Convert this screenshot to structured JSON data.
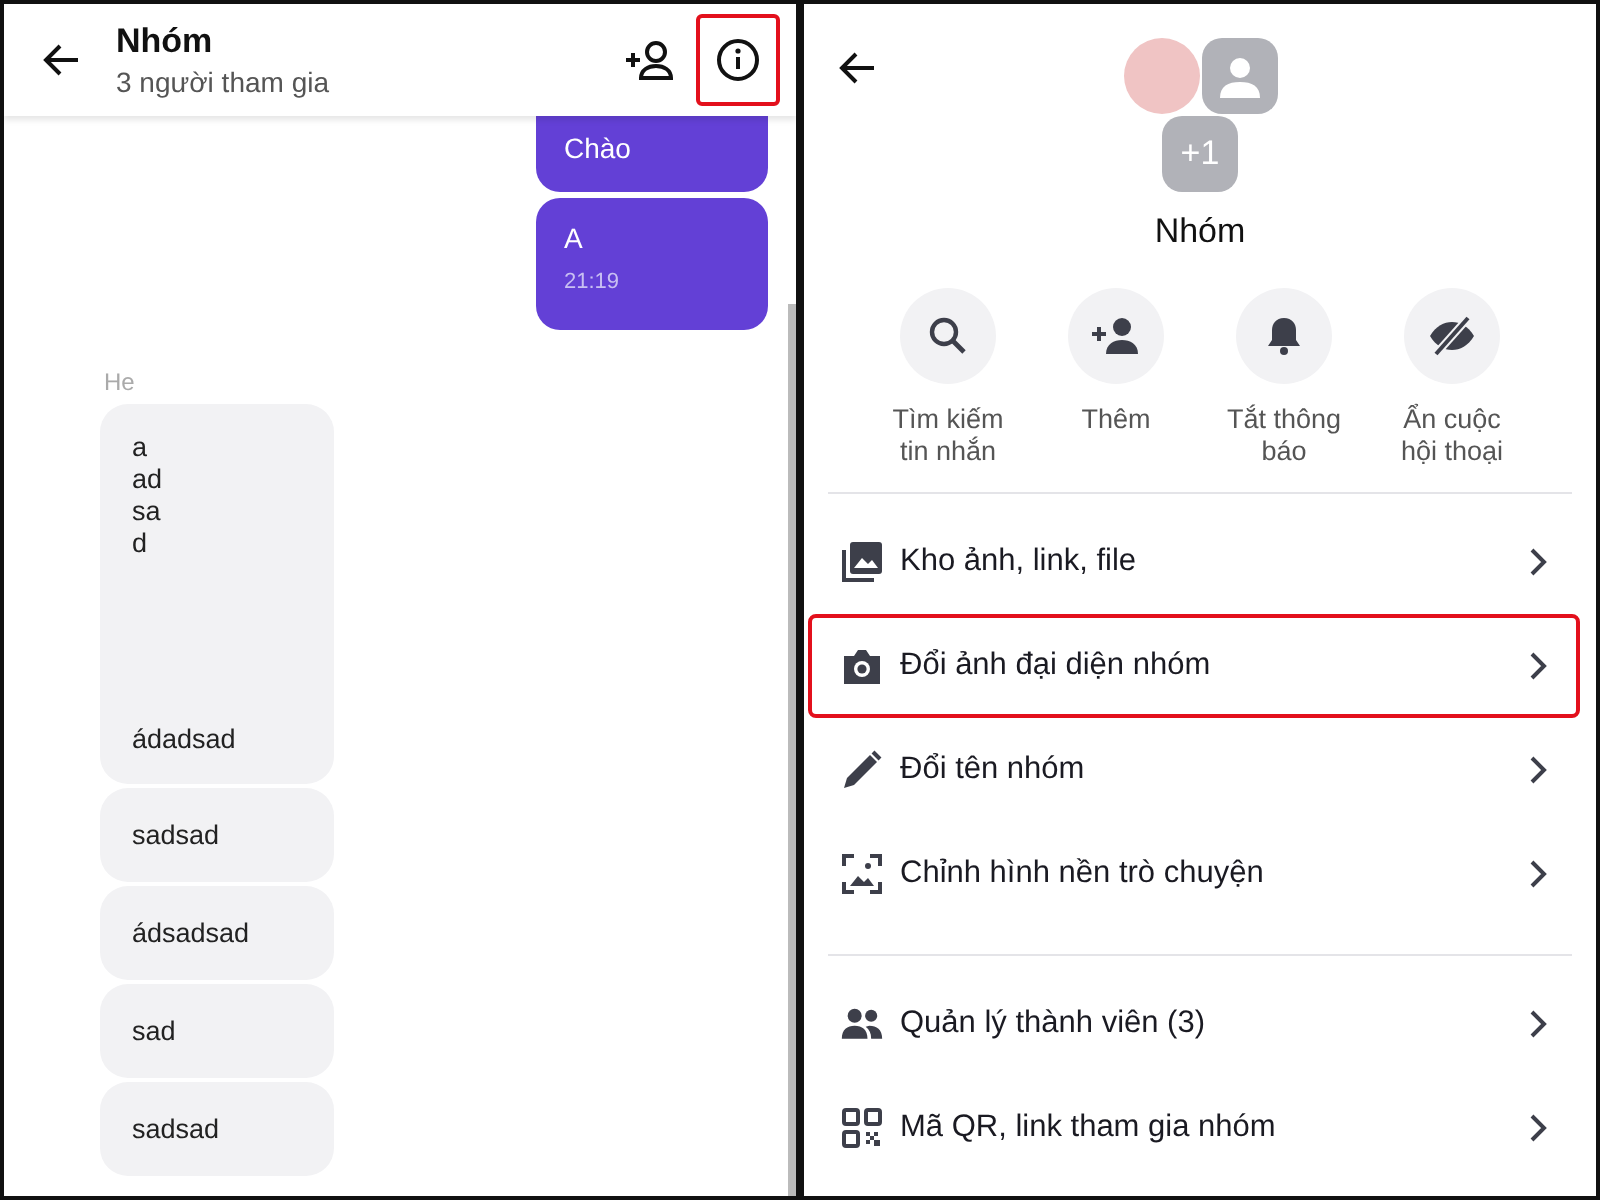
{
  "chat": {
    "title": "Nhóm",
    "subtitle": "3 người tham gia",
    "info_highlighted": true,
    "sent": [
      {
        "text": "Chào"
      },
      {
        "text": "A",
        "time": "21:19"
      }
    ],
    "sender": "He",
    "received": [
      {
        "lines": [
          "a",
          "ad",
          "sa",
          "d"
        ],
        "tail": "ádadsad"
      },
      {
        "lines": [
          "sadsad"
        ]
      },
      {
        "lines": [
          "ádsadsad"
        ]
      },
      {
        "lines": [
          "sad"
        ]
      },
      {
        "lines": [
          "sadsad"
        ]
      }
    ]
  },
  "info": {
    "name": "Nhóm",
    "more_members": "+1",
    "actions": [
      {
        "kind": "search",
        "label": "Tìm kiếm tin nhắn"
      },
      {
        "kind": "add",
        "label": "Thêm"
      },
      {
        "kind": "mute",
        "label": "Tắt thông báo"
      },
      {
        "kind": "hide",
        "label": "Ẩn cuộc hội thoại"
      }
    ],
    "sections": [
      [
        {
          "kind": "media",
          "label": "Kho ảnh, link, file",
          "highlighted": false
        },
        {
          "kind": "camera",
          "label": "Đổi ảnh đại diện nhóm",
          "highlighted": true
        },
        {
          "kind": "rename",
          "label": "Đổi tên nhóm",
          "highlighted": false
        },
        {
          "kind": "wallpaper",
          "label": "Chỉnh hình nền trò chuyện",
          "highlighted": false
        }
      ],
      [
        {
          "kind": "members",
          "label": "Quản lý thành viên (3)",
          "highlighted": false
        },
        {
          "kind": "qr",
          "label": "Mã QR, link tham gia nhóm",
          "highlighted": false
        }
      ]
    ]
  }
}
